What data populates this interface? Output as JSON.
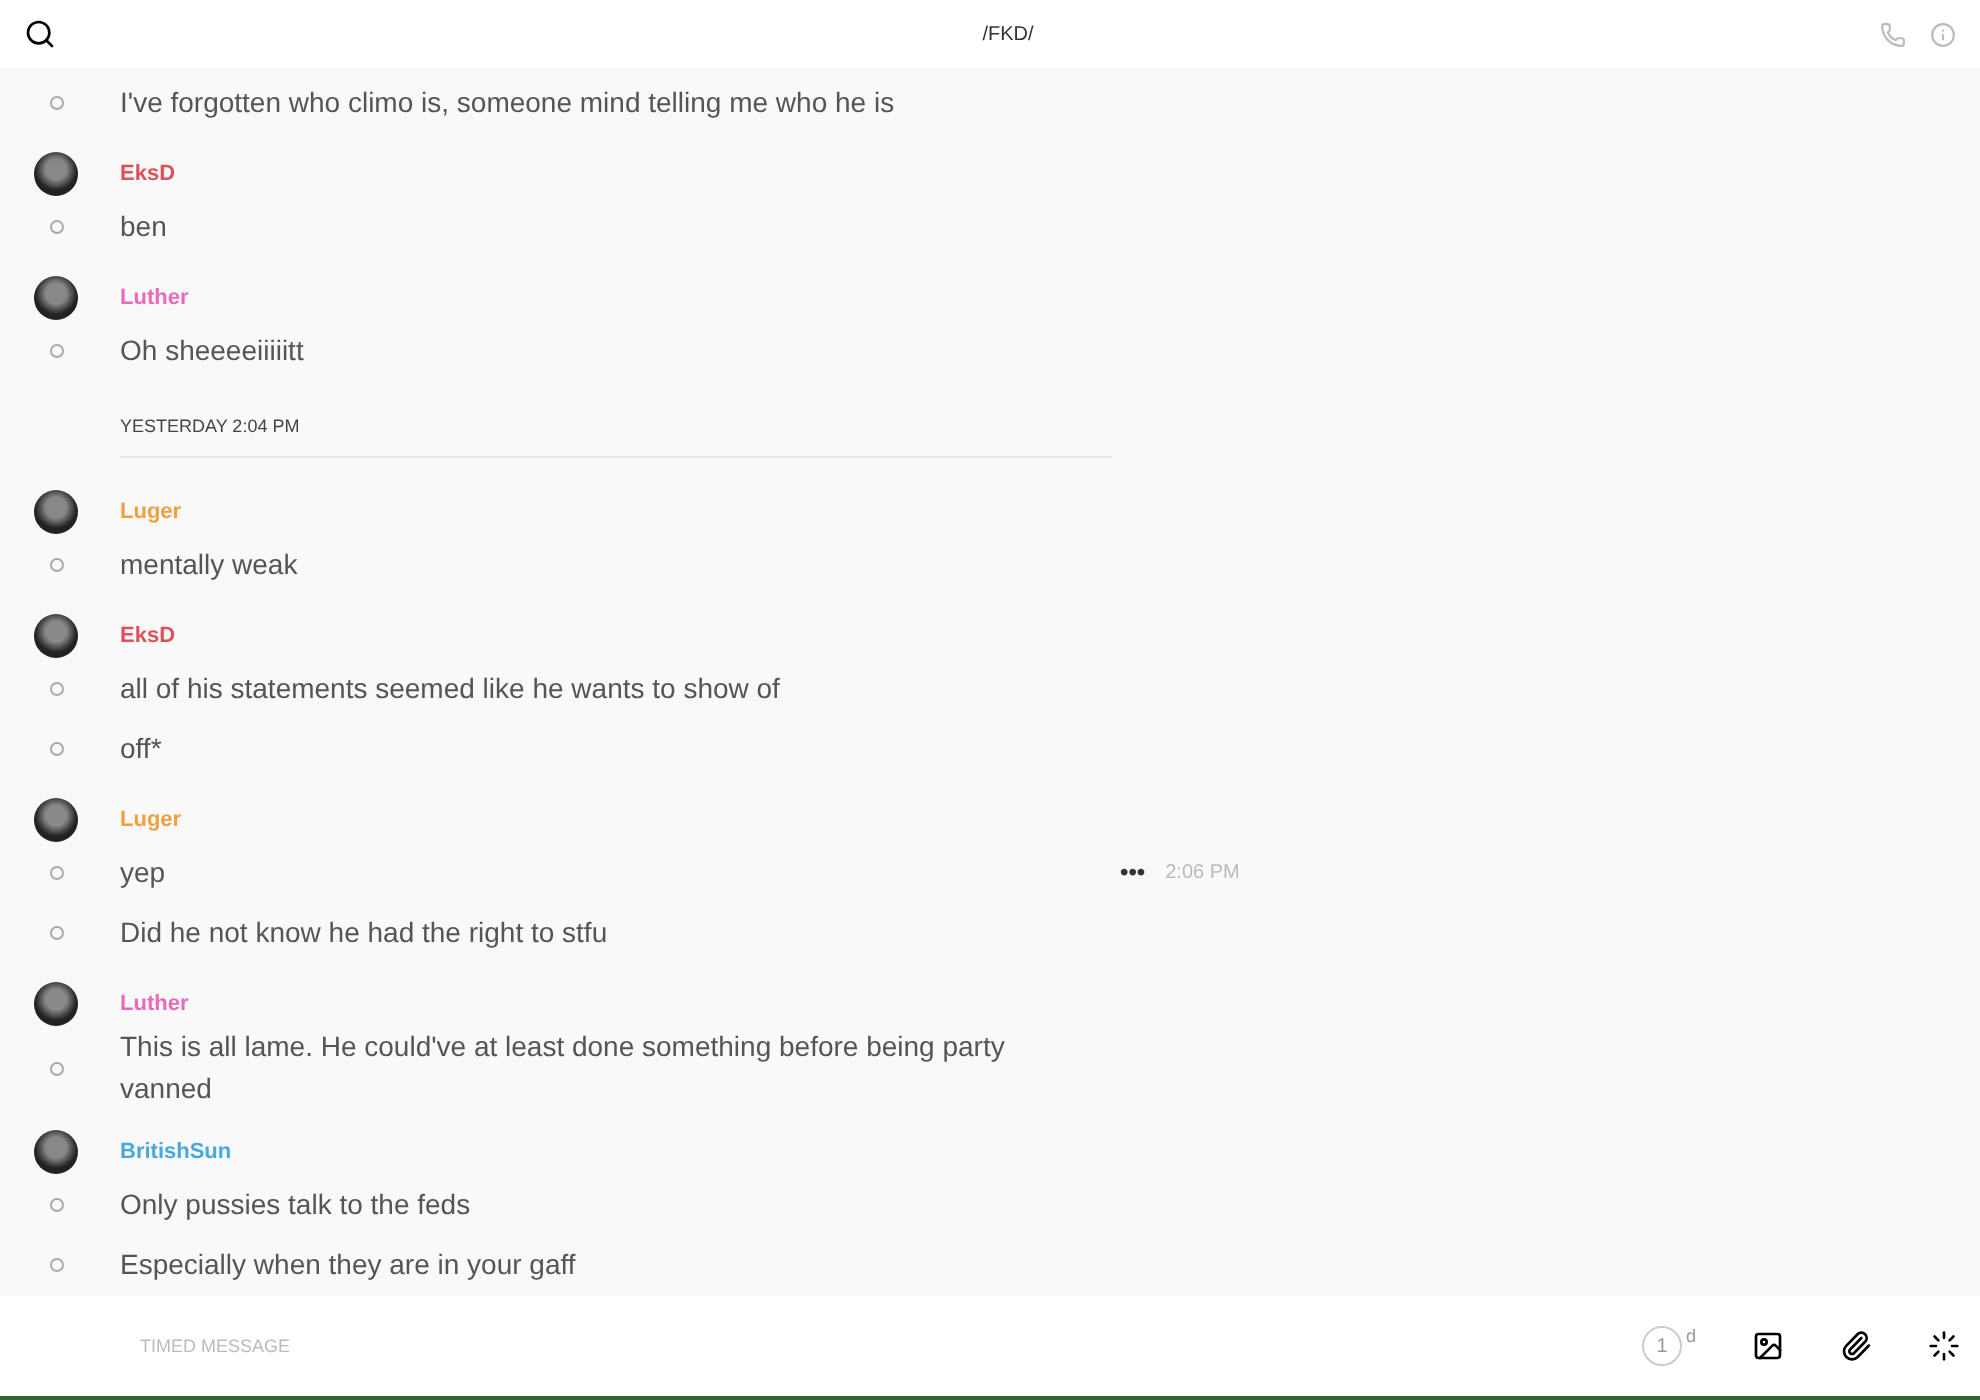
{
  "header": {
    "title": "/FKD/"
  },
  "feed": [
    {
      "kind": "message",
      "lines": [
        {
          "text": "I've forgotten who climo is, someone mind telling me who he is"
        }
      ]
    },
    {
      "kind": "message",
      "author": "EksD",
      "color": "#e0505a",
      "lines": [
        {
          "text": "ben"
        }
      ]
    },
    {
      "kind": "message",
      "author": "Luther",
      "color": "#e86ab8",
      "lines": [
        {
          "text": "Oh sheeeeiiiiitt"
        }
      ]
    },
    {
      "kind": "divider",
      "label": "YESTERDAY 2:04 PM"
    },
    {
      "kind": "message",
      "author": "Luger",
      "color": "#f0a040",
      "lines": [
        {
          "text": "mentally weak"
        }
      ]
    },
    {
      "kind": "message",
      "author": "EksD",
      "color": "#e0505a",
      "lines": [
        {
          "text": "all of his statements seemed like he wants to show of"
        },
        {
          "text": "off*"
        }
      ]
    },
    {
      "kind": "message",
      "author": "Luger",
      "color": "#f0a040",
      "lines": [
        {
          "text": "yep",
          "hovered": true,
          "more": "•••",
          "time": "2:06 PM"
        },
        {
          "text": "Did he not know he had the right to stfu"
        }
      ]
    },
    {
      "kind": "message",
      "author": "Luther",
      "color": "#e86ab8",
      "lines": [
        {
          "text": "This is all lame. He could've at least done something before being party vanned"
        }
      ]
    },
    {
      "kind": "message",
      "author": "BritishSun",
      "color": "#4aa8e0",
      "lines": [
        {
          "text": "Only pussies talk to the feds"
        },
        {
          "text": "Especially when they are in your gaff"
        }
      ]
    }
  ],
  "composer": {
    "placeholder": "TIMED MESSAGE",
    "timer": "1",
    "timer_unit": "d"
  }
}
